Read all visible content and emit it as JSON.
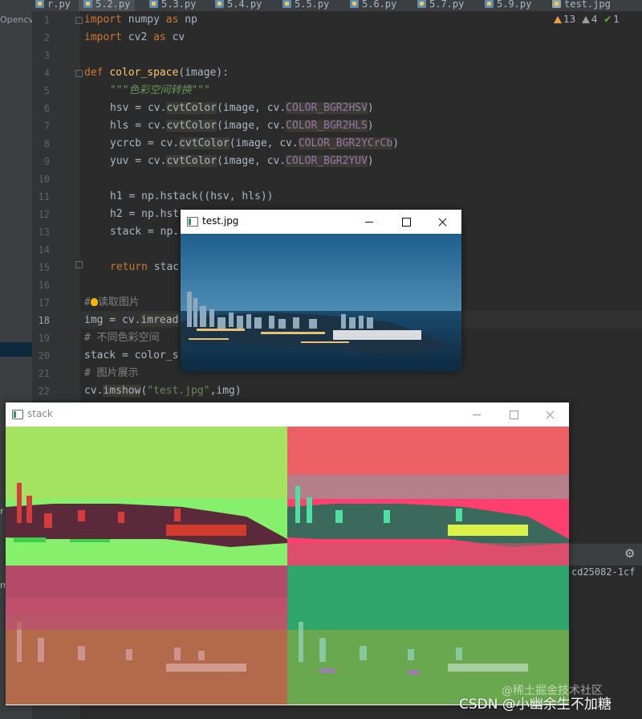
{
  "tabs": [
    {
      "label": "r.py"
    },
    {
      "label": "5.2.py"
    },
    {
      "label": "5.3.py"
    },
    {
      "label": "5.4.py"
    },
    {
      "label": "5.5.py"
    },
    {
      "label": "5.6.py"
    },
    {
      "label": "5.7.py"
    },
    {
      "label": "5.9.py"
    },
    {
      "label": "test.jpg"
    }
  ],
  "project_label": "Opencv",
  "inspections": {
    "warnings": "13",
    "weak_warnings": "4",
    "ok": "1"
  },
  "line_numbers": [
    "1",
    "2",
    "3",
    "4",
    "5",
    "6",
    "7",
    "8",
    "9",
    "10",
    "11",
    "12",
    "13",
    "14",
    "15",
    "16",
    "17",
    "18",
    "19",
    "20",
    "21",
    "22"
  ],
  "code": {
    "l1_kw": "import",
    "l1_rest": " numpy ",
    "l1_as": "as",
    "l1_alias": " np",
    "l2_kw": "import",
    "l2_rest": " cv2 ",
    "l2_as": "as",
    "l2_alias": " cv",
    "l4_def": "def ",
    "l4_fn": "color_space",
    "l4_rest": "(image):",
    "l5_doc": "\"\"\"色彩空间转换\"\"\"",
    "l6_a": "hsv = cv.",
    "l6_fn": "cvtColor",
    "l6_b": "(image, cv.",
    "l6_c": "COLOR_BGR2HSV",
    "l6_d": ")",
    "l7_a": "hls = cv.",
    "l7_fn": "cvtColor",
    "l7_b": "(image, cv.",
    "l7_c": "COLOR_BGR2HLS",
    "l7_d": ")",
    "l8_a": "ycrcb = cv.",
    "l8_fn": "cvtColor",
    "l8_b": "(image, cv.",
    "l8_c": "COLOR_BGR2YCrCb",
    "l8_d": ")",
    "l9_a": "yuv = cv.",
    "l9_fn": "cvtColor",
    "l9_b": "(image, cv.",
    "l9_c": "COLOR_BGR2YUV",
    "l9_d": ")",
    "l11": "h1 = np.hstack((hsv, hls))",
    "l12": "h2 = np.hst",
    "l13": "stack = np.",
    "l15_kw": "return",
    "l15_rest": " stac",
    "l17_hash": "#",
    "l17_text": "读取图片",
    "l18_a": "img = cv.",
    "l18_b": "imread",
    "l19": "# 不同色彩空间",
    "l20": "stack = color_s",
    "l21": "# 图片展示",
    "l22_a": "cv.",
    "l22_fn": "imshow",
    "l22_b": "(",
    "l22_str": "\"test.jpg\"",
    "l22_c": ",img)"
  },
  "run_output": "cd25082-1cf",
  "window_test": {
    "title": "test.jpg"
  },
  "window_stack": {
    "title": "stack"
  },
  "watermark": {
    "main": "CSDN @小幽余生不加糖",
    "faint": "@稀土掘金技术社区"
  },
  "colors": {
    "ide_bg": "#2b2b2b",
    "keyword": "#cc7832",
    "function": "#ffc66d",
    "string": "#6a8759",
    "comment": "#808080"
  }
}
